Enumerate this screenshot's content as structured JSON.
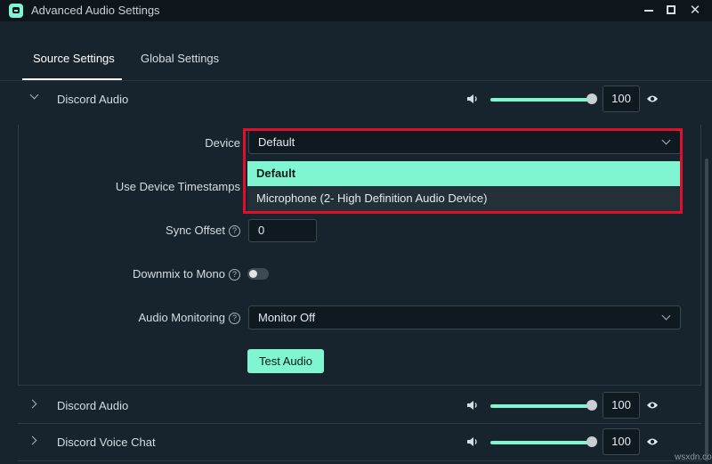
{
  "window": {
    "title": "Advanced Audio Settings",
    "min_glyph": "",
    "max_glyph": "",
    "close_glyph": "✕"
  },
  "tabs": [
    {
      "label": "Source Settings",
      "active": true
    },
    {
      "label": "Global Settings",
      "active": false
    }
  ],
  "sources": [
    {
      "name": "Discord Audio",
      "volume": "100",
      "expanded": true
    },
    {
      "name": "Discord Audio",
      "volume": "100",
      "expanded": false
    },
    {
      "name": "Discord Voice Chat",
      "volume": "100",
      "expanded": false
    }
  ],
  "settings": {
    "device": {
      "label": "Device",
      "value": "Default"
    },
    "device_options": [
      "Default",
      "Microphone (2- High Definition Audio Device)"
    ],
    "timestamps": {
      "label": "Use Device Timestamps"
    },
    "sync_offset": {
      "label": "Sync Offset",
      "value": "0"
    },
    "downmix": {
      "label": "Downmix to Mono",
      "on": false
    },
    "monitoring": {
      "label": "Audio Monitoring",
      "value": "Monitor Off"
    },
    "test_button": "Test Audio",
    "help_glyph": "?"
  },
  "watermark": "wsxdn.com",
  "colors": {
    "accent": "#80f5d2",
    "background": "#17242d",
    "highlight": "#e0102a"
  },
  "icons": [
    "app-icon",
    "minimize-icon",
    "maximize-icon",
    "close-icon",
    "chevron-down-icon",
    "chevron-right-icon",
    "speaker-icon",
    "eye-icon",
    "help-icon"
  ]
}
